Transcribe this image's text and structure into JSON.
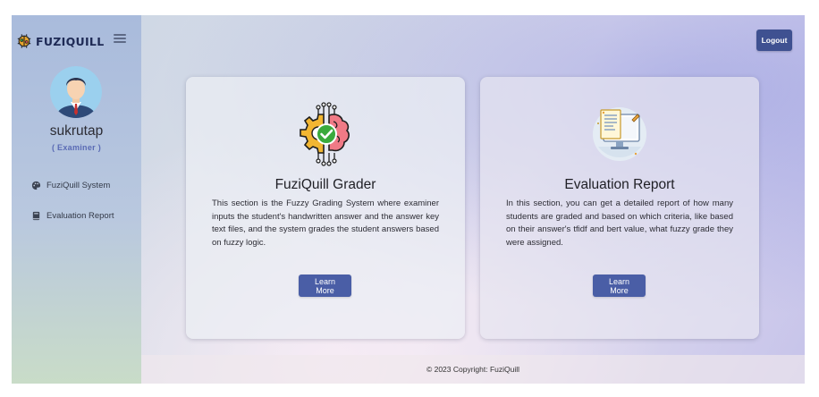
{
  "brand": {
    "name": "FUZIQUILL",
    "logo_icon": "brain-chip-icon"
  },
  "sidebar": {
    "menu_icon": "hamburger-icon",
    "avatar_icon": "user-avatar-icon",
    "username": "sukrutap",
    "role": "( Examiner )",
    "items": [
      {
        "label": "FuziQuill System",
        "icon": "palette-icon"
      },
      {
        "label": "Evaluation Report",
        "icon": "book-icon"
      }
    ]
  },
  "header": {
    "logout_label": "Logout"
  },
  "cards": [
    {
      "title": "FuziQuill Grader",
      "icon": "gear-brain-check-icon",
      "text": "This section is the Fuzzy Grading System where examiner inputs the student's handwritten answer and the answer key text files, and the system grades the student answers based on fuzzy logic.",
      "button": "Learn More"
    },
    {
      "title": "Evaluation Report",
      "icon": "report-monitor-icon",
      "text": "In this section, you can get a detailed report of how many students are graded and based on which criteria, like based on their answer's tfidf and bert value, what fuzzy grade they were assigned.",
      "button": "Learn More"
    }
  ],
  "footer": {
    "text": "© 2023 Copyright: FuziQuill"
  },
  "colors": {
    "accent": "#4a5ea6",
    "logout_bg": "#3f5191",
    "role_text": "#5a6bb5"
  }
}
